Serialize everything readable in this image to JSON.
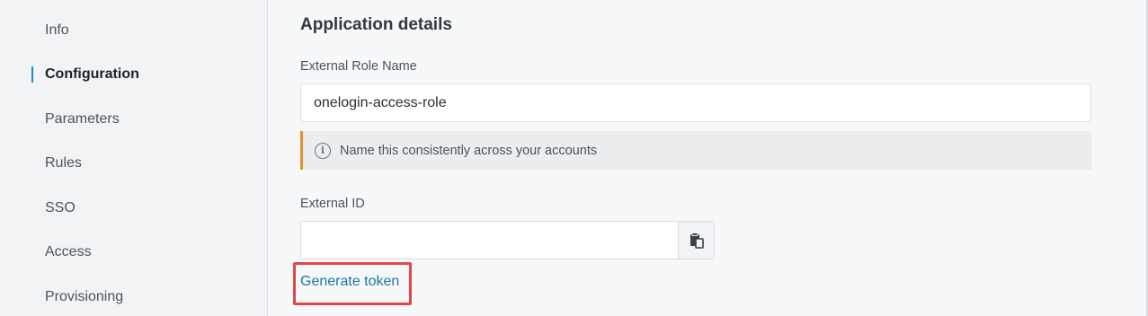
{
  "sidebar": {
    "items": [
      {
        "label": "Info"
      },
      {
        "label": "Configuration",
        "active": true
      },
      {
        "label": "Parameters"
      },
      {
        "label": "Rules"
      },
      {
        "label": "SSO"
      },
      {
        "label": "Access"
      },
      {
        "label": "Provisioning"
      }
    ]
  },
  "main": {
    "title": "Application details",
    "external_role": {
      "label": "External Role Name",
      "value": "onelogin-access-role"
    },
    "notice": {
      "icon": "info-icon",
      "text": "Name this consistently across your accounts"
    },
    "external_id": {
      "label": "External ID",
      "value": "",
      "copy_icon": "clipboard-icon"
    },
    "generate_link": "Generate token"
  },
  "colors": {
    "accent": "#1a8fc4",
    "link": "#167aa1",
    "notice_border": "#e8912d",
    "highlight": "#e4474a"
  }
}
